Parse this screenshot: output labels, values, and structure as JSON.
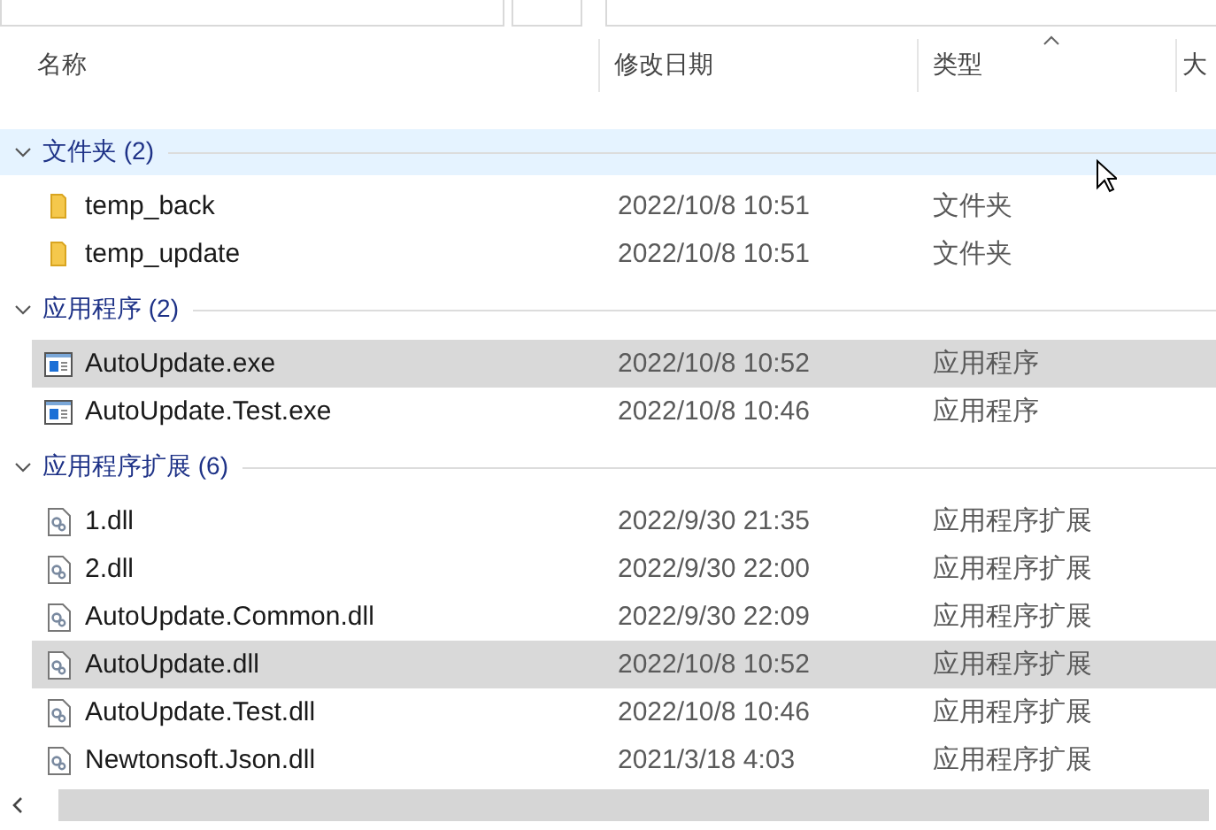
{
  "columns": [
    {
      "label": "名称"
    },
    {
      "label": "修改日期"
    },
    {
      "label": "类型",
      "sorted": true
    },
    {
      "label": "大"
    }
  ],
  "groups": [
    {
      "label": "文件夹 (2)",
      "expanded": true,
      "hovered": true,
      "items": [
        {
          "name": "temp_back",
          "date": "2022/10/8 10:51",
          "type": "文件夹",
          "kind": "folder",
          "selected": false
        },
        {
          "name": "temp_update",
          "date": "2022/10/8 10:51",
          "type": "文件夹",
          "kind": "folder",
          "selected": false
        }
      ]
    },
    {
      "label": "应用程序 (2)",
      "expanded": true,
      "hovered": false,
      "items": [
        {
          "name": "AutoUpdate.exe",
          "date": "2022/10/8 10:52",
          "type": "应用程序",
          "kind": "exe",
          "selected": true
        },
        {
          "name": "AutoUpdate.Test.exe",
          "date": "2022/10/8 10:46",
          "type": "应用程序",
          "kind": "exe",
          "selected": false
        }
      ]
    },
    {
      "label": "应用程序扩展 (6)",
      "expanded": true,
      "hovered": false,
      "items": [
        {
          "name": "1.dll",
          "date": "2022/9/30 21:35",
          "type": "应用程序扩展",
          "kind": "dll",
          "selected": false
        },
        {
          "name": "2.dll",
          "date": "2022/9/30 22:00",
          "type": "应用程序扩展",
          "kind": "dll",
          "selected": false
        },
        {
          "name": "AutoUpdate.Common.dll",
          "date": "2022/9/30 22:09",
          "type": "应用程序扩展",
          "kind": "dll",
          "selected": false
        },
        {
          "name": "AutoUpdate.dll",
          "date": "2022/10/8 10:52",
          "type": "应用程序扩展",
          "kind": "dll",
          "selected": true
        },
        {
          "name": "AutoUpdate.Test.dll",
          "date": "2022/10/8 10:46",
          "type": "应用程序扩展",
          "kind": "dll",
          "selected": false
        },
        {
          "name": "Newtonsoft.Json.dll",
          "date": "2021/3/18 4:03",
          "type": "应用程序扩展",
          "kind": "dll",
          "selected": false
        }
      ]
    }
  ]
}
